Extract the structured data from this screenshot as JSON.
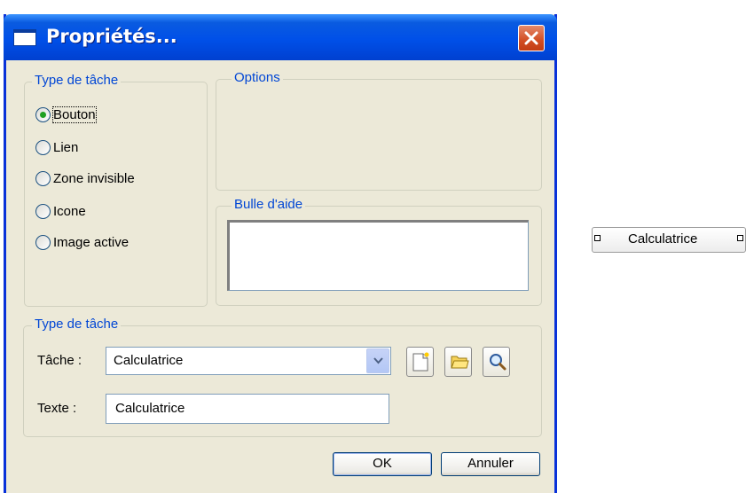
{
  "window": {
    "title": "Propriétés..."
  },
  "task_type_group": {
    "legend": "Type de tâche",
    "options": [
      {
        "label": "Bouton",
        "checked": true
      },
      {
        "label": "Lien",
        "checked": false
      },
      {
        "label": "Zone invisible",
        "checked": false
      },
      {
        "label": "Icone",
        "checked": false
      },
      {
        "label": "Image active",
        "checked": false
      }
    ]
  },
  "options_group": {
    "legend": "Options"
  },
  "tooltip_group": {
    "legend": "Bulle d'aide",
    "value": ""
  },
  "task_group": {
    "legend": "Type de tâche",
    "task_label": "Tâche :",
    "task_value": "Calculatrice",
    "text_label": "Texte :",
    "text_value": "Calculatrice"
  },
  "buttons": {
    "ok": "OK",
    "cancel": "Annuler"
  },
  "preview": {
    "label": "Calculatrice"
  },
  "icons": [
    "window-icon",
    "close-icon",
    "dropdown-arrow-icon",
    "new-document-icon",
    "open-folder-icon",
    "magnifier-icon"
  ],
  "colors": {
    "titlebar": "#0050e8",
    "dialog_bg": "#ece9d8",
    "legend_text": "#0046d5",
    "close_button": "#d24d23",
    "radio_checked": "#21a121"
  }
}
